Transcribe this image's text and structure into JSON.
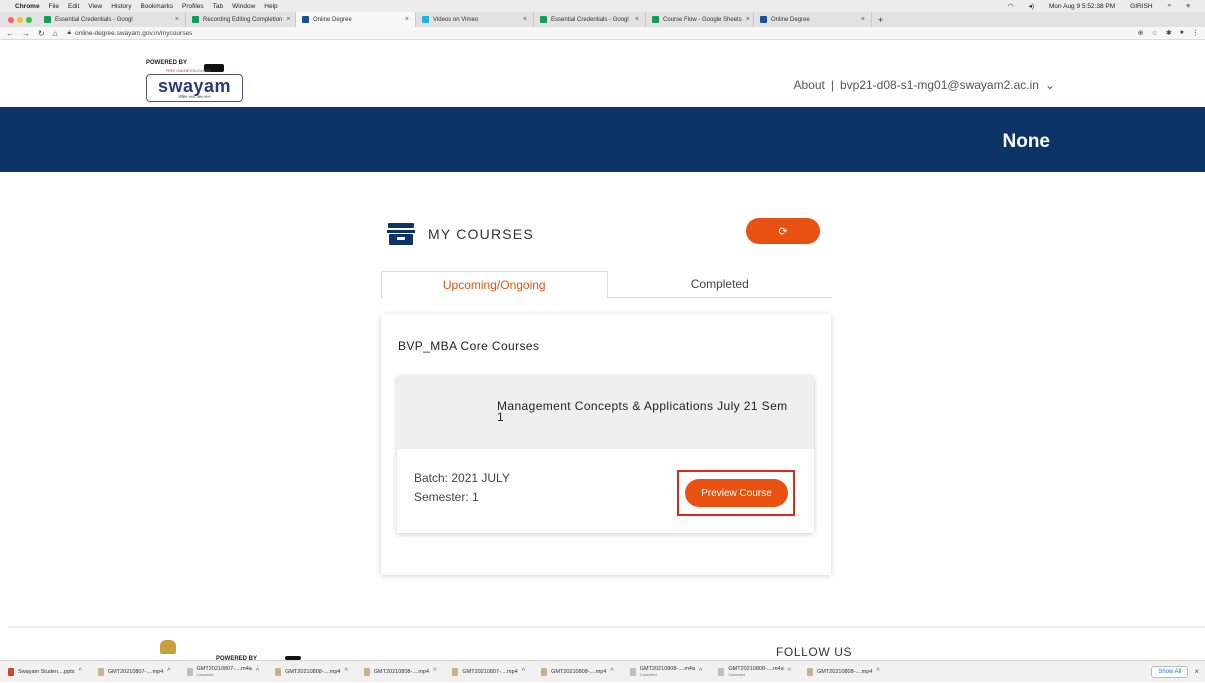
{
  "mac_menu": {
    "apple": "",
    "app": "Chrome",
    "items": [
      "File",
      "Edit",
      "View",
      "History",
      "Bookmarks",
      "Profiles",
      "Tab",
      "Window",
      "Help"
    ],
    "clock": "Mon Aug 9  5:52:38 PM",
    "user": "GIRISH"
  },
  "browser_tabs": [
    {
      "label": "Essential Credentials - Googl",
      "color": "#0f9d58",
      "active": false
    },
    {
      "label": "Recording Editing Completion",
      "color": "#0f9d58",
      "active": false
    },
    {
      "label": "Online Degree",
      "color": "#1a4fa0",
      "active": true
    },
    {
      "label": "Videos on Vimeo",
      "color": "#1ab7ea",
      "active": false
    },
    {
      "label": "Essential Credentials - Googl",
      "color": "#0f9d58",
      "active": false
    },
    {
      "label": "Course Flow - Google Sheets",
      "color": "#0f9d58",
      "active": false
    },
    {
      "label": "Online Degree",
      "color": "#1a4fa0",
      "active": false
    }
  ],
  "address": {
    "url": "online-degree.swayam.gov.in/mycourses"
  },
  "logo": {
    "powered_by": "POWERED BY",
    "brand": "swayam",
    "free": "FREE ONLINE EDUCATION",
    "tagline": "शिक्षित भारत, उन्नत भारत"
  },
  "header": {
    "about": "About",
    "separator": "|",
    "account": "bvp21-d08-s1-mg01@swayam2.ac.in"
  },
  "banner": {
    "title": "None"
  },
  "my_courses": {
    "title": "MY COURSES",
    "refresh_icon": "refresh-icon"
  },
  "course_tabs": [
    {
      "label": "Upcoming/Ongoing"
    },
    {
      "label": "Completed"
    }
  ],
  "program": {
    "title": "BVP_MBA Core Courses"
  },
  "course": {
    "name": "Management Concepts & Applications July 21 Sem 1",
    "batch": "Batch: 2021 JULY",
    "semester": "Semester: 1",
    "preview_button": "Preview Course"
  },
  "footer": {
    "powered_by": "POWERED BY",
    "follow_us": "FOLLOW US"
  },
  "downloads": [
    {
      "name": "Swayam Studen....pptx",
      "type": "pptx",
      "sub": ""
    },
    {
      "name": "GMT20210807-....mp4",
      "type": "mp4",
      "sub": ""
    },
    {
      "name": "GMT20210807-....m4a",
      "type": "m4a",
      "sub": "Canceled"
    },
    {
      "name": "GMT20210808-....mp4",
      "type": "mp4",
      "sub": ""
    },
    {
      "name": "GMT20210808-....mp4",
      "type": "mp4",
      "sub": ""
    },
    {
      "name": "GMT20210807-....mp4",
      "type": "mp4",
      "sub": ""
    },
    {
      "name": "GMT20210808-....mp4",
      "type": "mp4",
      "sub": ""
    },
    {
      "name": "GMT20210808-....m4a",
      "type": "m4a",
      "sub": "Canceled"
    },
    {
      "name": "GMT20210808-....m4a",
      "type": "m4a",
      "sub": "Canceled"
    },
    {
      "name": "GMT20210808-....mp4",
      "type": "mp4",
      "sub": ""
    }
  ],
  "downloads_bar": {
    "show_all": "Show All",
    "close": "×"
  },
  "colors": {
    "accent": "#e8510f",
    "banner": "#0c3466",
    "highlight": "#d9281e"
  }
}
